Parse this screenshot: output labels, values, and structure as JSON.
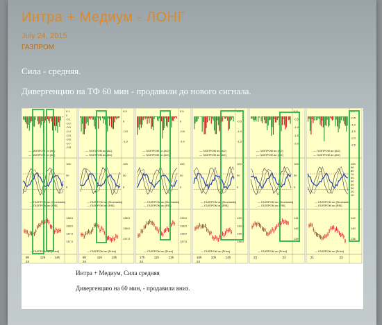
{
  "post": {
    "title": "Интра + Медиум - ЛОНГ",
    "date": "July 24, 2015",
    "category": "ГАЗПРОМ",
    "line1": "Сила - средняя.",
    "line2": "Дивергенцию на ТФ 60 мин - продавили до нового сигнала."
  },
  "image": {
    "caption1": "Интра + Медиум, Сила средняя",
    "caption2": "Дивергенцию на 60 мин, - продавили вниз.",
    "panels": [
      {
        "ac_legend": "ГАЗПРОМ ао [AC]",
        "stoch_legend": "ГАЗПРОМ ао [Stochastic]",
        "rsi_legend": "ГАЗПРОМ ао [RSI]",
        "price_legend": "ГАЗПРОМ ао [Price]",
        "ac_ticks": [
          "0.1",
          "0",
          "-0.1",
          "-0.2",
          "-0.3",
          "-0.4",
          "-0.5",
          "-0.6",
          "-0.7",
          "-0.8"
        ],
        "osc_ticks": [
          "100",
          "50",
          "0"
        ],
        "price_ticks": [
          "138.5",
          "138.0",
          "137.5",
          "137.0"
        ],
        "time_ticks": [
          "9h",
          "12h",
          "14h"
        ],
        "date_label": "24"
      },
      {
        "ac_legend": "ГАЗПРОМ ао [AC]",
        "stoch_legend": "ГАЗПРОМ ао [Stochastic]",
        "rsi_legend": "ГАЗПРОМ ао [RSI]",
        "price_legend": "ГАЗПРОМ ао [Price]",
        "ac_ticks": [
          "0.5",
          "0",
          "-0.5",
          "-1.0"
        ],
        "osc_ticks": [
          "100",
          "50",
          "0"
        ],
        "price_ticks": [
          "138.5",
          "138.0",
          "137.5"
        ],
        "time_ticks": [
          "9h",
          "11h",
          "13h"
        ],
        "date_label": "24"
      },
      {
        "ac_legend": "ГАЗПРОМ ао [AO]",
        "stoch_legend": "ГАЗПРОМ ао [Stochastic]",
        "rsi_legend": "ГАЗПРОМ ао [RSI]",
        "price_legend": "ГАЗПРОМ ао [Price]",
        "ac_ticks": [
          "0.5",
          "0",
          "-0.5",
          "-1.0"
        ],
        "osc_ticks": [
          "100",
          "50",
          "0"
        ],
        "price_ticks": [
          "139.0",
          "138.5",
          "138.0",
          "137.5"
        ],
        "time_ticks": [
          "17h",
          "11h",
          "13h"
        ],
        "date_label": "24"
      },
      {
        "ac_legend": "ГАЗПРОМ ао [AO]",
        "stoch_legend": "ГАЗПРОМ ао [Stochastic]",
        "rsi_legend": "ГАЗПРОМ ао [RSI]",
        "price_legend": "ГАЗПРОМ ао [Price]",
        "ac_ticks": [
          "0.0",
          "-0.5",
          "-1.0",
          "-1.5"
        ],
        "osc_ticks": [
          "100",
          "50",
          "0"
        ],
        "price_ticks": [
          "139.5",
          "139.0",
          "138.5",
          "138.0"
        ],
        "time_ticks": [
          "16h",
          "10h",
          "14h"
        ],
        "date_label": "24"
      },
      {
        "ac_legend": "ГАЗПРОМ ао [AO]",
        "stoch_legend": "ГАЗПРОМ ао [Stochastic]",
        "rsi_legend": "ГАЗПРОМ ао [RSI]",
        "price_legend": "ГАЗПРОМ ао [Price]",
        "ac_ticks": [
          "0.0",
          "-0.5",
          "-1.0",
          "-1.5",
          "-2.0"
        ],
        "osc_ticks": [
          "100",
          "50",
          "0"
        ],
        "price_ticks": [
          "141",
          "140",
          "139"
        ],
        "time_ticks": [
          "23",
          "24"
        ],
        "date_label": ""
      },
      {
        "ac_legend": "ГАЗПРОМ ао [AO]",
        "stoch_legend": "ГАЗПРОМ ао [Stochastic]",
        "rsi_legend": "ГАЗПРОМ ао [RSI]",
        "price_legend": "ГАЗПРОМ ао [Price]",
        "ac_ticks": [
          "0.0",
          "-0.5",
          "-1.0",
          "-1.5",
          "-2.0",
          "-2.5"
        ],
        "osc_ticks": [
          "100",
          "90",
          "80",
          "70",
          "60",
          "50",
          "40",
          "30",
          "20",
          "10"
        ],
        "price_ticks": [
          "142",
          "140",
          "138"
        ],
        "time_ticks": [
          "21",
          "23"
        ],
        "date_label": ""
      }
    ]
  },
  "colors": {
    "accent": "#d98a2a",
    "chart_bg": "#ffffc6",
    "highlight": "#2bb24a",
    "green_bar": "#2f9a3e",
    "red_bar": "#d81c1c",
    "blue_line": "#1f3fb4"
  }
}
